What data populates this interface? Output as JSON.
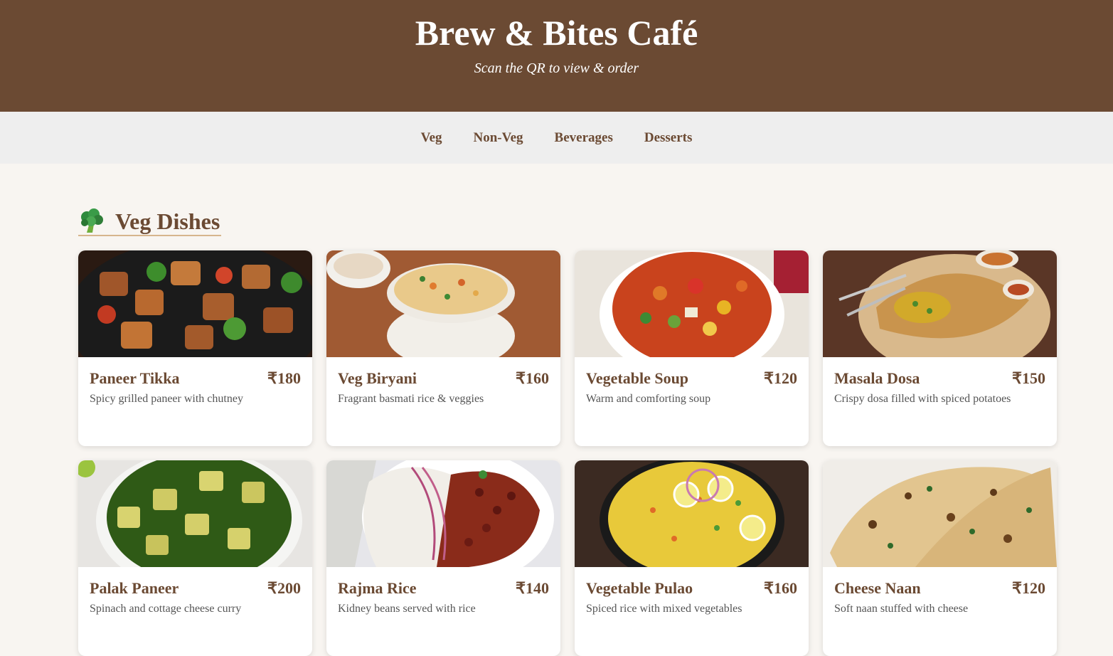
{
  "header": {
    "title": "Brew & Bites Café",
    "subtitle": "Scan the QR to view & order"
  },
  "nav": {
    "items": [
      "Veg",
      "Non-Veg",
      "Beverages",
      "Desserts"
    ]
  },
  "section": {
    "icon": "broccoli-icon",
    "title": "Veg Dishes"
  },
  "colors": {
    "brand_brown": "#6b4a33",
    "nav_bg": "#eeeeee",
    "page_bg": "#f8f5f1",
    "underline": "#d6b58d"
  },
  "dishes": [
    {
      "name": "Paneer Tikka",
      "price": "₹180",
      "desc": "Spicy grilled paneer with chutney",
      "image": "paneer-tikka-photo"
    },
    {
      "name": "Veg Biryani",
      "price": "₹160",
      "desc": "Fragrant basmati rice & veggies",
      "image": "veg-biryani-photo"
    },
    {
      "name": "Vegetable Soup",
      "price": "₹120",
      "desc": "Warm and comforting soup",
      "image": "vegetable-soup-photo"
    },
    {
      "name": "Masala Dosa",
      "price": "₹150",
      "desc": "Crispy dosa filled with spiced potatoes",
      "image": "masala-dosa-photo"
    },
    {
      "name": "Palak Paneer",
      "price": "₹200",
      "desc": "Spinach and cottage cheese curry",
      "image": "palak-paneer-photo"
    },
    {
      "name": "Rajma Rice",
      "price": "₹140",
      "desc": "Kidney beans served with rice",
      "image": "rajma-rice-photo"
    },
    {
      "name": "Vegetable Pulao",
      "price": "₹160",
      "desc": "Spiced rice with mixed vegetables",
      "image": "vegetable-pulao-photo"
    },
    {
      "name": "Cheese Naan",
      "price": "₹120",
      "desc": "Soft naan stuffed with cheese",
      "image": "cheese-naan-photo"
    }
  ]
}
